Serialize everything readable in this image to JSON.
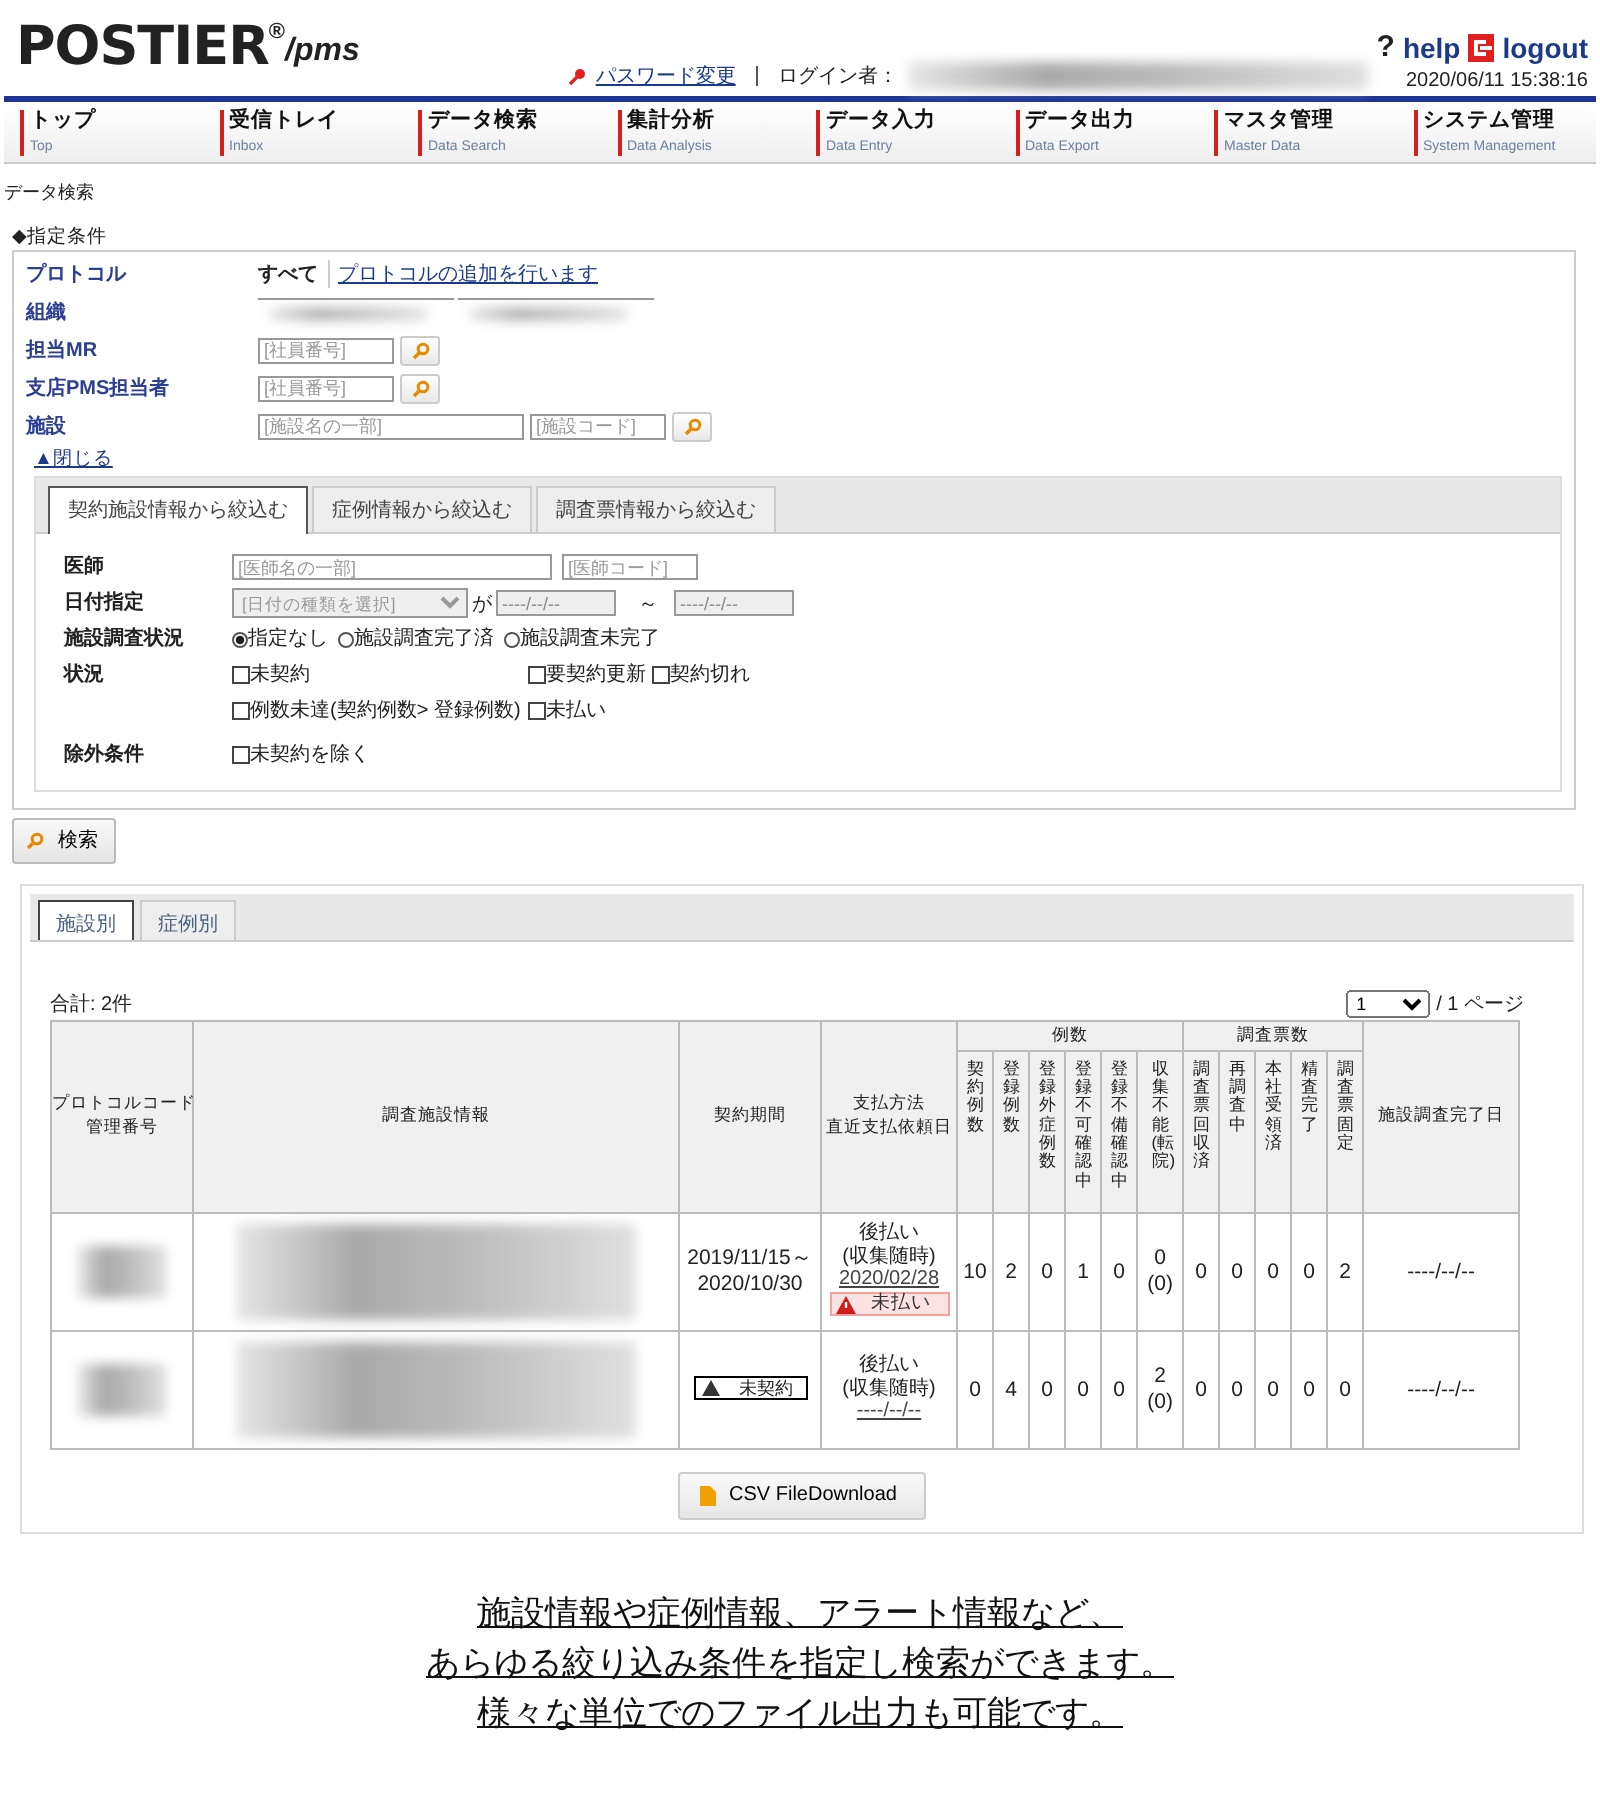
{
  "header": {
    "logo": "POSTIER",
    "logo_mark": "®",
    "logo_suffix": "/pms",
    "password_link": "パスワード変更",
    "login_label": "ログイン者：",
    "datetime": "2020/06/11 15:38:16",
    "help_mark": "?",
    "help": "help",
    "logout": "logout"
  },
  "nav": [
    {
      "label": "トップ",
      "sub": "Top"
    },
    {
      "label": "受信トレイ",
      "sub": "Inbox"
    },
    {
      "label": "データ検索",
      "sub": "Data Search"
    },
    {
      "label": "集計分析",
      "sub": "Data Analysis"
    },
    {
      "label": "データ入力",
      "sub": "Data Entry"
    },
    {
      "label": "データ出力",
      "sub": "Data Export"
    },
    {
      "label": "マスタ管理",
      "sub": "Master Data"
    },
    {
      "label": "システム管理",
      "sub": "System Management"
    }
  ],
  "breadcrumb": "データ検索",
  "conditions": {
    "title": "◆指定条件",
    "rows": [
      {
        "kind": "protocol",
        "label": "プロトコル",
        "value": "すべて",
        "link": "プロトコルの追加を行います"
      },
      {
        "kind": "redacted",
        "label": "組織"
      },
      {
        "kind": "lookup",
        "label": "担当MR",
        "fields": [
          {
            "placeholder": "[社員番号]"
          }
        ]
      },
      {
        "kind": "lookup",
        "label": "支店PMS担当者",
        "fields": [
          {
            "placeholder": "[社員番号]"
          }
        ]
      },
      {
        "kind": "lookup",
        "label": "施設",
        "fields": [
          {
            "placeholder": "[施設名の一部]"
          },
          {
            "placeholder": "[施設コード]"
          }
        ]
      }
    ],
    "close_link": "▲閉じる",
    "tabs": [
      {
        "label": "契約施設情報から絞込む",
        "selected": true
      },
      {
        "label": "症例情報から絞込む",
        "selected": false
      },
      {
        "label": "調査票情報から絞込む",
        "selected": false
      }
    ],
    "filters": [
      {
        "kind": "fields",
        "label": "医師",
        "fields": [
          {
            "placeholder": "[医師名の一部]"
          },
          {
            "placeholder": "[医師コード]"
          }
        ]
      },
      {
        "kind": "date",
        "label": "日付指定",
        "select": "[日付の種類を選択]",
        "joiner": "が",
        "from": "----/--/--",
        "tilde": "～",
        "to": "----/--/--"
      },
      {
        "kind": "radio",
        "label": "施設調査状況",
        "options": [
          {
            "label": "指定なし",
            "selected": true
          },
          {
            "label": "施設調査完了済",
            "selected": false
          },
          {
            "label": "施設調査未完了",
            "selected": false
          }
        ]
      },
      {
        "kind": "checks",
        "label": "状況",
        "options": [
          {
            "label": "未契約",
            "checked": false
          },
          {
            "label": "要契約更新",
            "checked": false
          },
          {
            "label": "契約切れ",
            "checked": false
          },
          {
            "label": "例数未達(契約例数> 登録例数)",
            "checked": false
          },
          {
            "label": "未払い",
            "checked": false
          }
        ]
      },
      {
        "kind": "checks",
        "label": "除外条件",
        "options": [
          {
            "label": "未契約を除く",
            "checked": false
          }
        ]
      }
    ],
    "search_button": "検索"
  },
  "results": {
    "tabs": [
      {
        "label": "施設別",
        "selected": true
      },
      {
        "label": "症例別",
        "selected": false
      }
    ],
    "total": "合計:  2件",
    "page": "1",
    "page_suffix": "/ 1 ページ",
    "columns": [
      {
        "kind": "plain",
        "lines": [
          "プロトコルコード",
          "管理番号"
        ]
      },
      {
        "kind": "plain",
        "lines": [
          "調査施設情報"
        ]
      },
      {
        "kind": "plain",
        "lines": [
          "契約期間"
        ]
      },
      {
        "kind": "plain",
        "lines": [
          "支払方法",
          "直近支払依頼日"
        ]
      },
      {
        "kind": "group",
        "label": "例数",
        "children": [
          "契約例数",
          "登録例数",
          "登録外症例数",
          "登録不可確認中",
          "登録不備確認中",
          "収集不能(転院)"
        ]
      },
      {
        "kind": "group",
        "label": "調査票数",
        "children": [
          "調査票回収済",
          "再調査中",
          "本社受領済",
          "精査完了",
          "調査票固定"
        ]
      },
      {
        "kind": "plain",
        "lines": [
          "施設調査完了日"
        ]
      }
    ],
    "rows": [
      {
        "period": {
          "kind": "dates",
          "lines": [
            "2019/11/15～",
            "2020/10/30"
          ]
        },
        "payment": [
          "後払い",
          "(収集随時)"
        ],
        "payment_date": "2020/02/28",
        "alert": "未払い",
        "counts": [
          "10",
          "2",
          "0",
          "1",
          "0"
        ],
        "uncollectable": [
          "0",
          "(0)"
        ],
        "surveys": [
          "0",
          "0",
          "0",
          "0",
          "2"
        ],
        "completed": "----/--/--"
      },
      {
        "period": {
          "kind": "badge",
          "label": "未契約"
        },
        "payment": [
          "後払い",
          "(収集随時)"
        ],
        "payment_date": "----/--/--",
        "counts": [
          "0",
          "4",
          "0",
          "0",
          "0"
        ],
        "uncollectable": [
          "2",
          "(0)"
        ],
        "surveys": [
          "0",
          "0",
          "0",
          "0",
          "0"
        ],
        "completed": "----/--/--"
      }
    ],
    "csv_button": "CSV FileDownload"
  },
  "caption": [
    "施設情報や症例情報、アラート情報など、",
    "あらゆる絞り込み条件を指定し検索ができます。",
    "様々な単位でのファイル出力も可能です。"
  ]
}
